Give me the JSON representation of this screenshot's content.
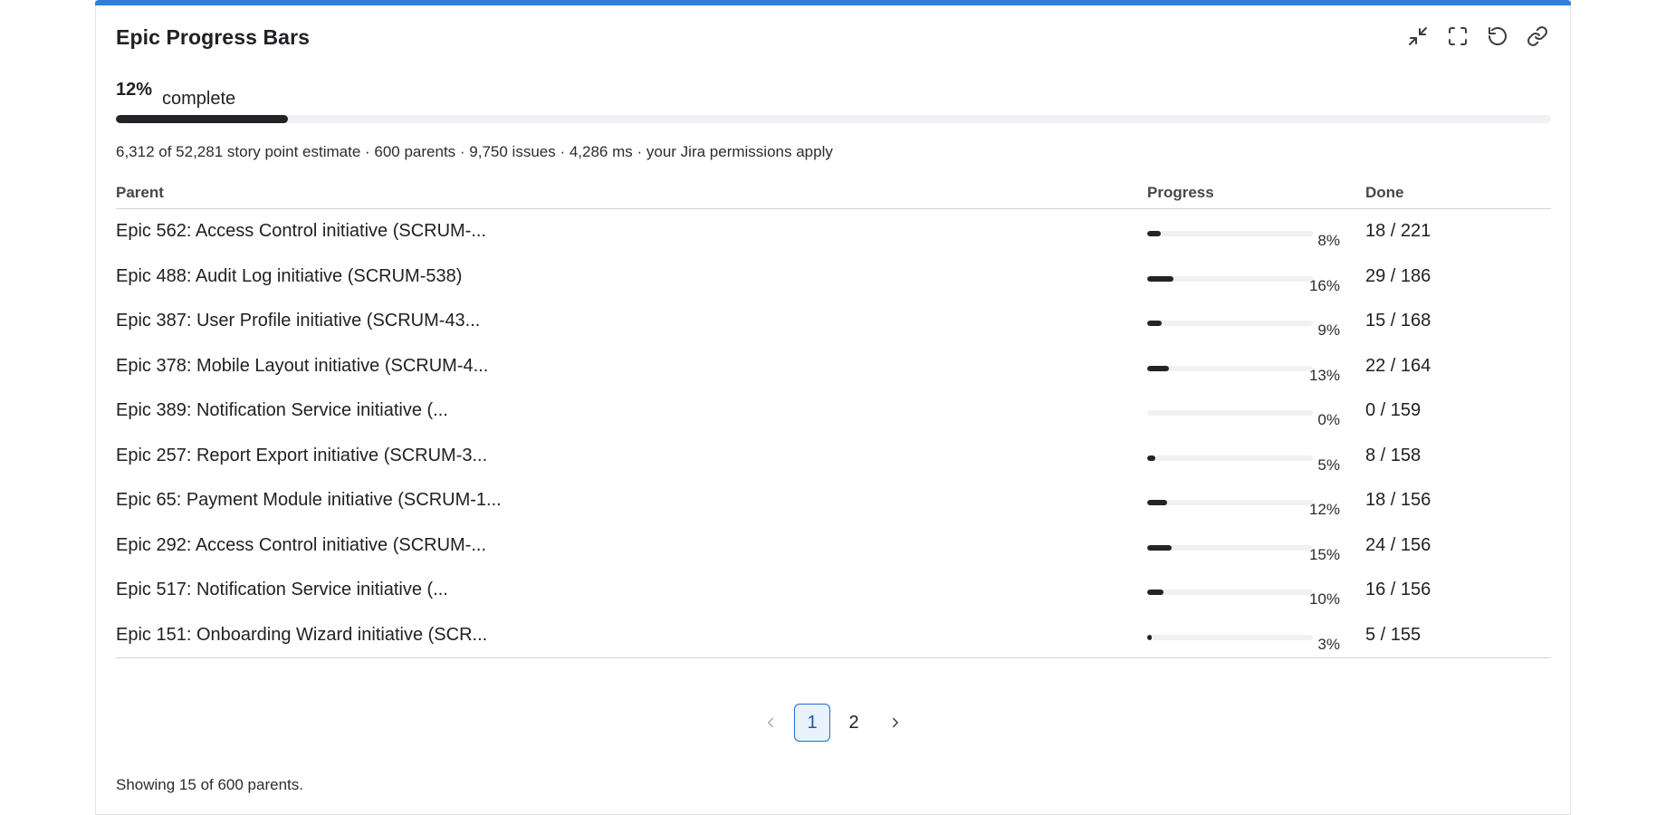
{
  "widget": {
    "title": "Epic Progress Bars",
    "actions": [
      {
        "name": "collapse-icon",
        "label": "Collapse"
      },
      {
        "name": "fullscreen-icon",
        "label": "Full screen"
      },
      {
        "name": "refresh-icon",
        "label": "Refresh"
      },
      {
        "name": "link-icon",
        "label": "Copy link"
      }
    ],
    "accent_color": "#2f7fdb"
  },
  "summary": {
    "percent_label": "12%",
    "complete_word": "complete",
    "percent_value": 12,
    "meta": "6,312 of 52,281 story point estimate · 600 parents · 9,750 issues · 4,286 ms · your Jira permissions apply"
  },
  "table": {
    "headers": {
      "parent": "Parent",
      "progress": "Progress",
      "done": "Done"
    },
    "rows": [
      {
        "parent": "Epic 562: Access Control initiative (SCRUM-...",
        "pct": 8,
        "pct_label": "8%",
        "done": "18 / 221"
      },
      {
        "parent": "Epic 488: Audit Log initiative (SCRUM-538)",
        "pct": 16,
        "pct_label": "16%",
        "done": "29 / 186"
      },
      {
        "parent": "Epic 387: User Profile initiative (SCRUM-43...",
        "pct": 9,
        "pct_label": "9%",
        "done": "15 / 168"
      },
      {
        "parent": "Epic 378: Mobile Layout initiative (SCRUM-4...",
        "pct": 13,
        "pct_label": "13%",
        "done": "22 / 164"
      },
      {
        "parent": "Epic 389: Notification Service initiative (...",
        "pct": 0,
        "pct_label": "0%",
        "done": "0 / 159"
      },
      {
        "parent": "Epic 257: Report Export initiative (SCRUM-3...",
        "pct": 5,
        "pct_label": "5%",
        "done": "8 / 158"
      },
      {
        "parent": "Epic 65: Payment Module initiative (SCRUM-1...",
        "pct": 12,
        "pct_label": "12%",
        "done": "18 / 156"
      },
      {
        "parent": "Epic 292: Access Control initiative (SCRUM-...",
        "pct": 15,
        "pct_label": "15%",
        "done": "24 / 156"
      },
      {
        "parent": "Epic 517: Notification Service initiative (...",
        "pct": 10,
        "pct_label": "10%",
        "done": "16 / 156"
      },
      {
        "parent": "Epic 151: Onboarding Wizard initiative (SCR...",
        "pct": 3,
        "pct_label": "3%",
        "done": "5 / 155"
      }
    ]
  },
  "pagination": {
    "pages": [
      "1",
      "2"
    ],
    "current": "1",
    "prev_icon": "chevron-left-icon",
    "next_icon": "chevron-right-icon"
  },
  "footer": {
    "note": "Showing 15 of 600 parents."
  }
}
